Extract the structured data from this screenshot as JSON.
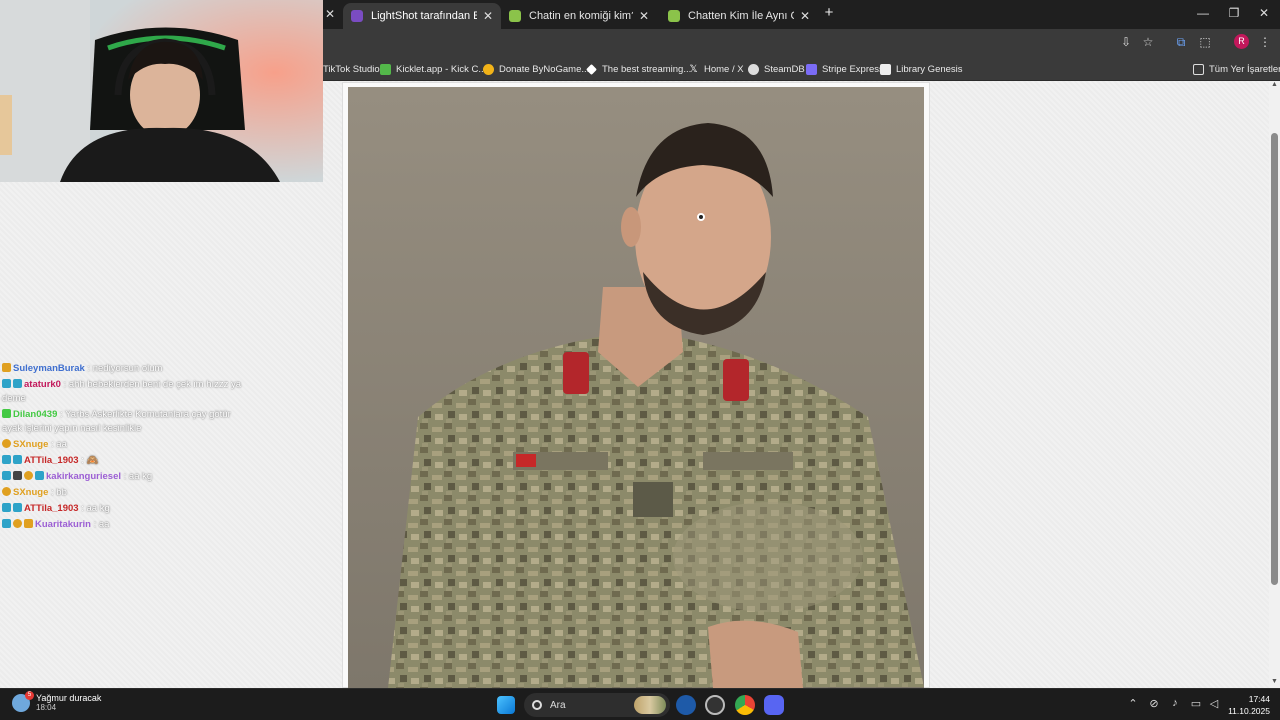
{
  "browser": {
    "tabs": [
      {
        "title": "LightShot tarafından Ekran Görüntüsü",
        "active": true,
        "color": "#7a4cc2"
      },
      {
        "title": "Chatin en komiği kim? - Quizei",
        "active": false,
        "color": "#8bc34a"
      },
      {
        "title": "Chatten Kim İle Aynı Cephede Savaşırsın",
        "active": false,
        "color": "#8bc34a"
      }
    ],
    "close_glyph": "✕",
    "newtab_glyph": "+",
    "bookmarks": [
      {
        "label": "TikTok Studio",
        "icon": "tiktok-icon"
      },
      {
        "label": "Kicklet.app - Kick C...",
        "icon": "kicklet-icon"
      },
      {
        "label": "Donate ByNoGame...",
        "icon": "bynogame-icon"
      },
      {
        "label": "The best streaming...",
        "icon": "streaming-icon"
      },
      {
        "label": "Home / X",
        "icon": "x-icon"
      },
      {
        "label": "SteamDB",
        "icon": "steamdb-icon"
      },
      {
        "label": "Stripe Express",
        "icon": "stripe-icon"
      },
      {
        "label": "Library Genesis",
        "icon": "libgen-icon"
      }
    ],
    "all_bookmarks_label": "Tüm Yer İşaretleri",
    "profile_initial": "R"
  },
  "chat": {
    "messages": [
      {
        "user": "SuleymanBurak",
        "user_color": "#3f6fcf",
        "text": ": nediyorsun olum",
        "badges": [
          "#e0a020"
        ]
      },
      {
        "user": "ataturk0",
        "user_color": "#c2185b",
        "text": ": ahh bebeklerden beni de çek im hızzz ya",
        "cont": "deme",
        "badges": [
          "#2ea3c8",
          "#2ea3c8"
        ]
      },
      {
        "user": "Dilan0439",
        "user_color": "#43c943",
        "text": ": Yarbs Askerlikte Komutanlara çay götür",
        "cont": "ayak işlerini yapın nasıl kesinlikle",
        "badges": [
          "#43c943"
        ]
      },
      {
        "user": "SXnuge",
        "user_color": "#e0a020",
        "text": ": aa",
        "badges": [
          "#e0a020"
        ]
      },
      {
        "user": "ATTila_1903",
        "user_color": "#c62828",
        "text": ": 🙈",
        "badges": [
          "#2ea3c8",
          "#2ea3c8"
        ]
      },
      {
        "user": "kakirkanguriesel",
        "user_color": "#9c5fd4",
        "text": ": aa kg",
        "badges": [
          "#2ea3c8",
          "#444444",
          "#e0a020",
          "#2ea3c8"
        ]
      },
      {
        "user": "SXnuge",
        "user_color": "#e0a020",
        "text": ": bb",
        "badges": [
          "#e0a020"
        ]
      },
      {
        "user": "ATTila_1903",
        "user_color": "#c62828",
        "text": ": aa kg",
        "badges": [
          "#2ea3c8",
          "#2ea3c8"
        ]
      },
      {
        "user": "Kuaritakurin",
        "user_color": "#9c5fd4",
        "text": ": aa",
        "badges": [
          "#2ea3c8",
          "#e0a020",
          "#e0a020"
        ]
      }
    ]
  },
  "taskbar": {
    "weather_title": "Yağmur duracak",
    "weather_time": "18:04",
    "weather_badge": "5",
    "search_placeholder": "Ara",
    "time": "17:44",
    "date": "11.10.2025"
  }
}
